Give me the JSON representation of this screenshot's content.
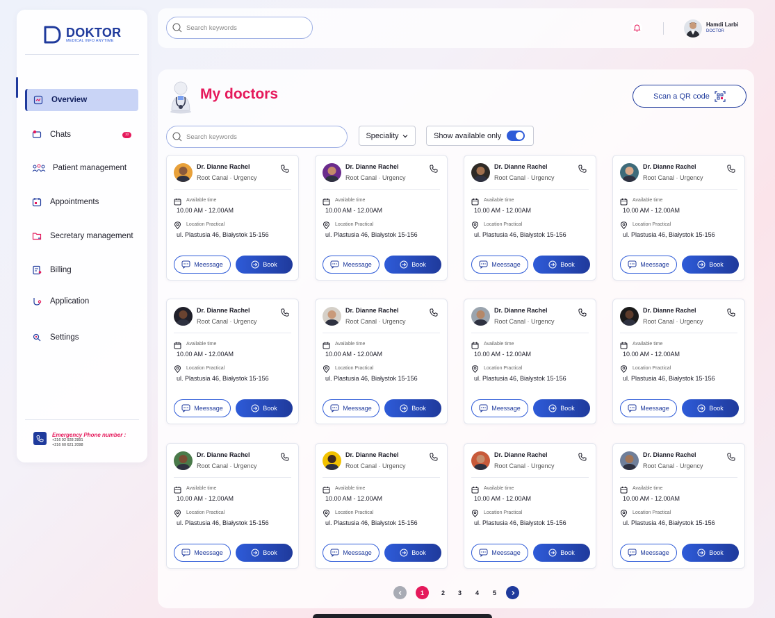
{
  "brand": {
    "name": "DOKTOR",
    "tagline": "MEDICAL INFO ANYTIME"
  },
  "sidebar": {
    "items": [
      {
        "label": "Overview",
        "icon": "overview-icon"
      },
      {
        "label": "Chats",
        "icon": "chat-icon",
        "badge": "10"
      },
      {
        "label": "Patient management",
        "icon": "patients-icon"
      },
      {
        "label": "Appointments",
        "icon": "calendar-icon"
      },
      {
        "label": "Secretary management",
        "icon": "folder-icon"
      },
      {
        "label": "Billing",
        "icon": "billing-icon"
      },
      {
        "label": "Application",
        "icon": "application-icon"
      },
      {
        "label": "Settings",
        "icon": "settings-icon"
      }
    ],
    "emergency": {
      "title": "Emergency Phone number :",
      "phone1": "+216 92 928 2891",
      "phone2": "+216 60 621 2098"
    }
  },
  "topbar": {
    "search_placeholder": "Search keywords",
    "user": {
      "name": "Hamdi Larbi",
      "role": "DOCTOR"
    }
  },
  "page": {
    "title": "My doctors",
    "qr_label": "Scan a QR code",
    "search_placeholder": "Search keywords",
    "speciality_label": "Speciality",
    "available_label": "Show available only",
    "available_on": true
  },
  "card_labels": {
    "available_time": "Available time",
    "location": "Location Practical",
    "message": "Meessage",
    "book": "Book"
  },
  "doctors": [
    {
      "name": "Dr. Dianne Rachel",
      "specialty": "Root Canal · Urgency",
      "time": "10.00 AM - 12.00AM",
      "address": "ul. Plastusia 46, Białystok 15-156"
    },
    {
      "name": "Dr. Dianne Rachel",
      "specialty": "Root Canal · Urgency",
      "time": "10.00 AM - 12.00AM",
      "address": "ul. Plastusia 46, Białystok 15-156"
    },
    {
      "name": "Dr. Dianne Rachel",
      "specialty": "Root Canal · Urgency",
      "time": "10.00 AM - 12.00AM",
      "address": "ul. Plastusia 46, Białystok 15-156"
    },
    {
      "name": "Dr. Dianne Rachel",
      "specialty": "Root Canal · Urgency",
      "time": "10.00 AM - 12.00AM",
      "address": "ul. Plastusia 46, Białystok 15-156"
    },
    {
      "name": "Dr. Dianne Rachel",
      "specialty": "Root Canal · Urgency",
      "time": "10.00 AM - 12.00AM",
      "address": "ul. Plastusia 46, Białystok 15-156"
    },
    {
      "name": "Dr. Dianne Rachel",
      "specialty": "Root Canal · Urgency",
      "time": "10.00 AM - 12.00AM",
      "address": "ul. Plastusia 46, Białystok 15-156"
    },
    {
      "name": "Dr. Dianne Rachel",
      "specialty": "Root Canal · Urgency",
      "time": "10.00 AM - 12.00AM",
      "address": "ul. Plastusia 46, Białystok 15-156"
    },
    {
      "name": "Dr. Dianne Rachel",
      "specialty": "Root Canal · Urgency",
      "time": "10.00 AM - 12.00AM",
      "address": "ul. Plastusia 46, Białystok 15-156"
    },
    {
      "name": "Dr. Dianne Rachel",
      "specialty": "Root Canal · Urgency",
      "time": "10.00 AM - 12.00AM",
      "address": "ul. Plastusia 46, Białystok 15-156"
    },
    {
      "name": "Dr. Dianne Rachel",
      "specialty": "Root Canal · Urgency",
      "time": "10.00 AM - 12.00AM",
      "address": "ul. Plastusia 46, Białystok 15-156"
    },
    {
      "name": "Dr. Dianne Rachel",
      "specialty": "Root Canal · Urgency",
      "time": "10.00 AM - 12.00AM",
      "address": "ul. Plastusia 46, Białystok 15-156"
    },
    {
      "name": "Dr. Dianne Rachel",
      "specialty": "Root Canal · Urgency",
      "time": "10.00 AM - 12.00AM",
      "address": "ul. Plastusia 46, Białystok 15-156"
    }
  ],
  "pagination": {
    "pages": [
      "1",
      "2",
      "3",
      "4",
      "5"
    ],
    "current": "1"
  },
  "colors": {
    "accent": "#e5195b",
    "primary": "#1f3a9c",
    "primary_light": "#2e5bd8",
    "nav_active_bg": "#c9d4f6"
  }
}
